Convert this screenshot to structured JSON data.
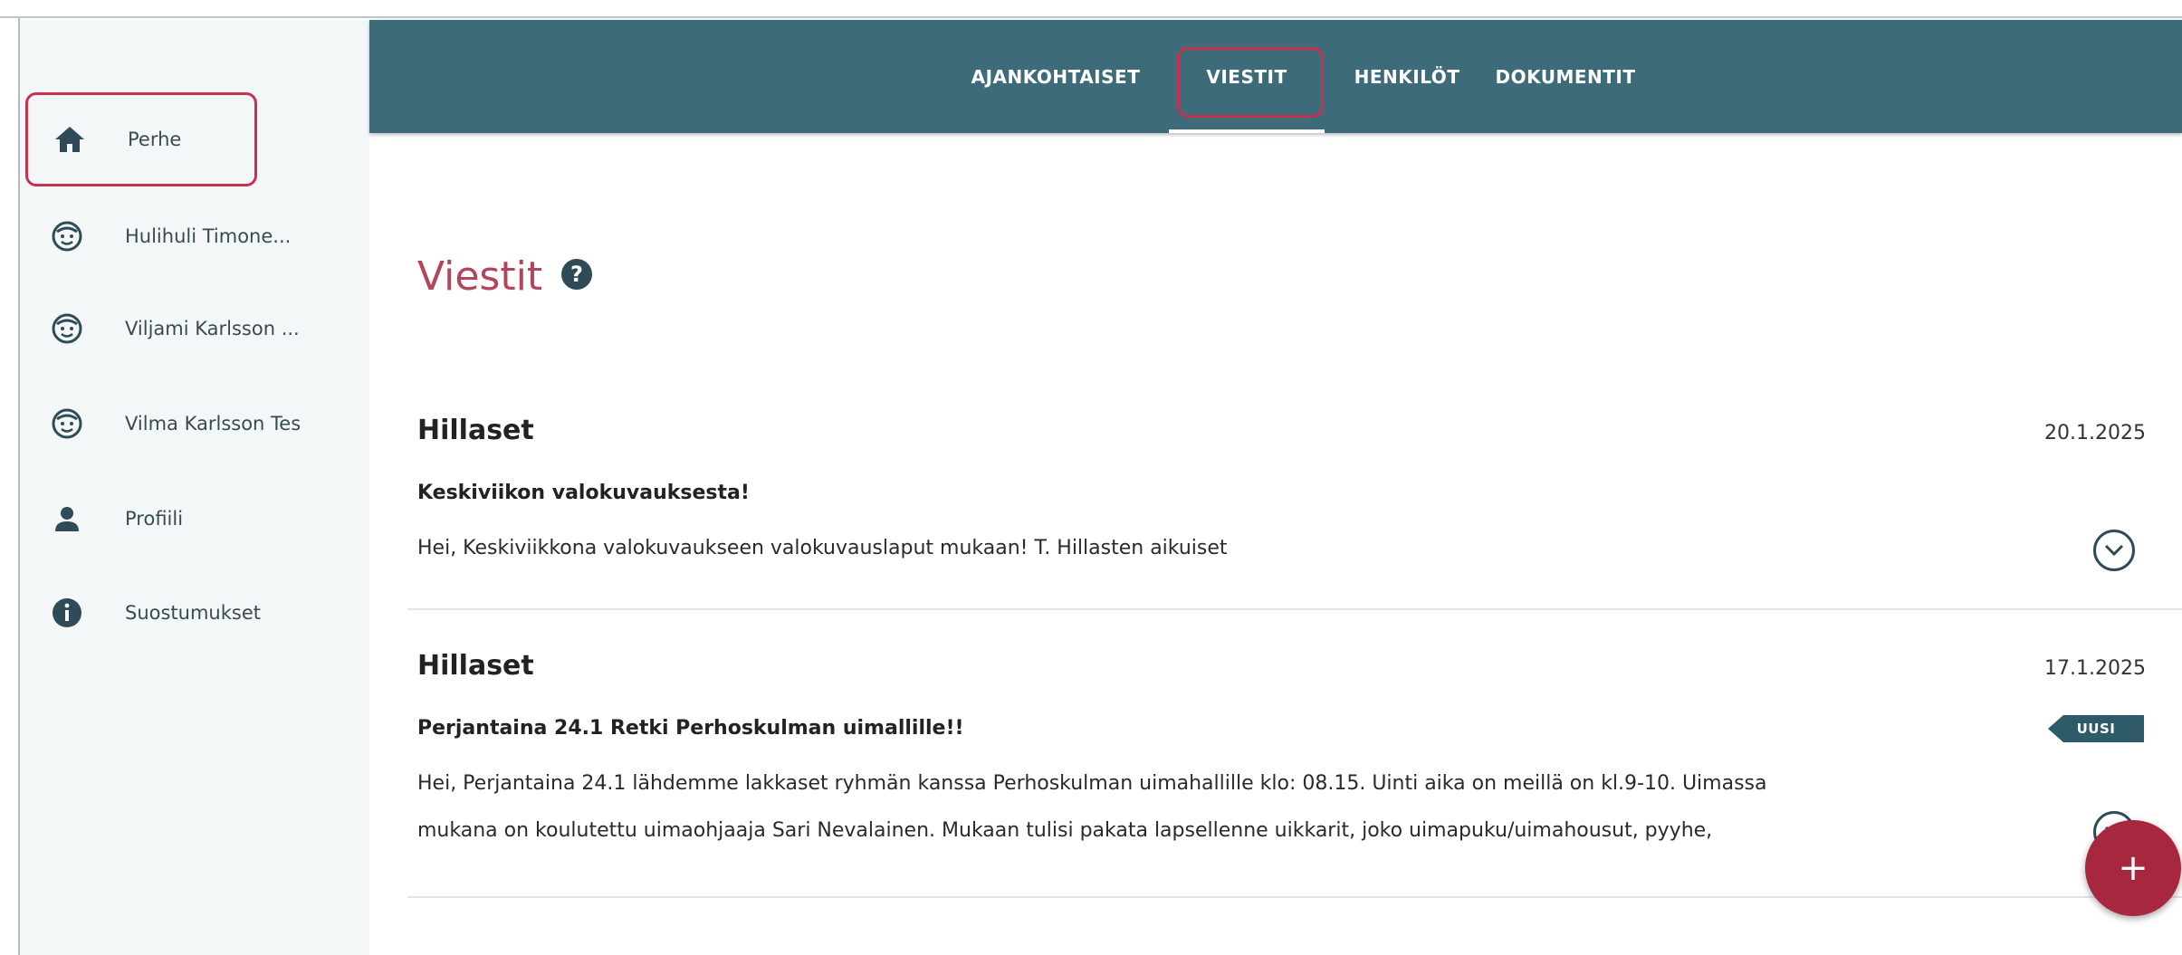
{
  "sidebar": {
    "items": [
      {
        "label": "Perhe",
        "icon": "home-icon",
        "active": true
      },
      {
        "label": "Hulihuli Timone...",
        "icon": "child-face-icon"
      },
      {
        "label": "Viljami Karlsson ...",
        "icon": "child-face-icon"
      },
      {
        "label": "Vilma Karlsson Tes",
        "icon": "child-face-icon"
      },
      {
        "label": "Profiili",
        "icon": "person-icon"
      },
      {
        "label": "Suostumukset",
        "icon": "info-icon"
      }
    ]
  },
  "topnav": {
    "tabs": [
      {
        "label": "AJANKOHTAISET"
      },
      {
        "label": "VIESTIT",
        "active": true
      },
      {
        "label": "HENKILÖT"
      },
      {
        "label": "DOKUMENTIT"
      }
    ]
  },
  "page": {
    "title": "Viestit",
    "help_icon": "?"
  },
  "messages": [
    {
      "sender": "Hillaset",
      "date": "20.1.2025",
      "subject": "Keskiviikon valokuvauksesta!",
      "body_lines": [
        "Hei, Keskiviikkona valokuvaukseen valokuvauslaput mukaan! T. Hillasten aikuiset"
      ]
    },
    {
      "sender": "Hillaset",
      "date": "17.1.2025",
      "subject": "Perjantaina 24.1 Retki Perhoskulman uimallille!!",
      "badge": "UUSI",
      "body_lines": [
        "Hei, Perjantaina 24.1 lähdemme lakkaset ryhmän kanssa Perhoskulman uimahallille klo: 08.15. Uinti aika on meillä on kl.9-10. Uimassa",
        "mukana on koulutettu uimaohjaaja Sari Nevalainen. Mukaan tulisi pakata lapsellenne uikkarit, joko uimapuku/uimahousut, pyyhe,"
      ]
    }
  ],
  "fab": {
    "label": "+"
  },
  "colors": {
    "nav_bg": "#3e6b79",
    "accent": "#b1455a",
    "fab": "#a7273f",
    "highlight_box": "#c8304e",
    "sidebar_bg": "#f3f7f8"
  }
}
